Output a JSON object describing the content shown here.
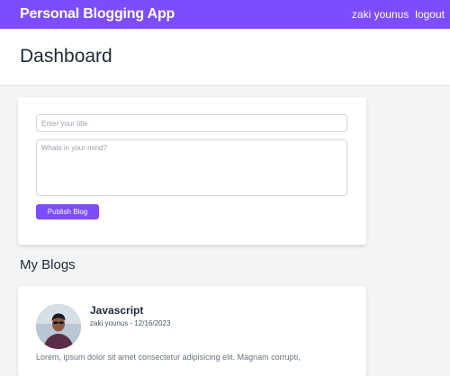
{
  "navbar": {
    "brand": "Personal Blogging App",
    "user_name": "zaki younus",
    "logout_label": "logout"
  },
  "header": {
    "title": "Dashboard"
  },
  "composer": {
    "title_placeholder": "Enter your title",
    "body_placeholder": "Whats in your mind?",
    "publish_label": "Publish Blog"
  },
  "my_blogs": {
    "section_title": "My Blogs",
    "posts": [
      {
        "title": "Javascript",
        "meta": "zaki younus - 12/16/2023",
        "excerpt": "Lorem, ipsum dolor sit amet consectetur adipisicing elit. Magnam corrupti,"
      }
    ]
  },
  "colors": {
    "brand": "#7c4dff",
    "background": "#f3f4f6",
    "card": "#ffffff"
  }
}
